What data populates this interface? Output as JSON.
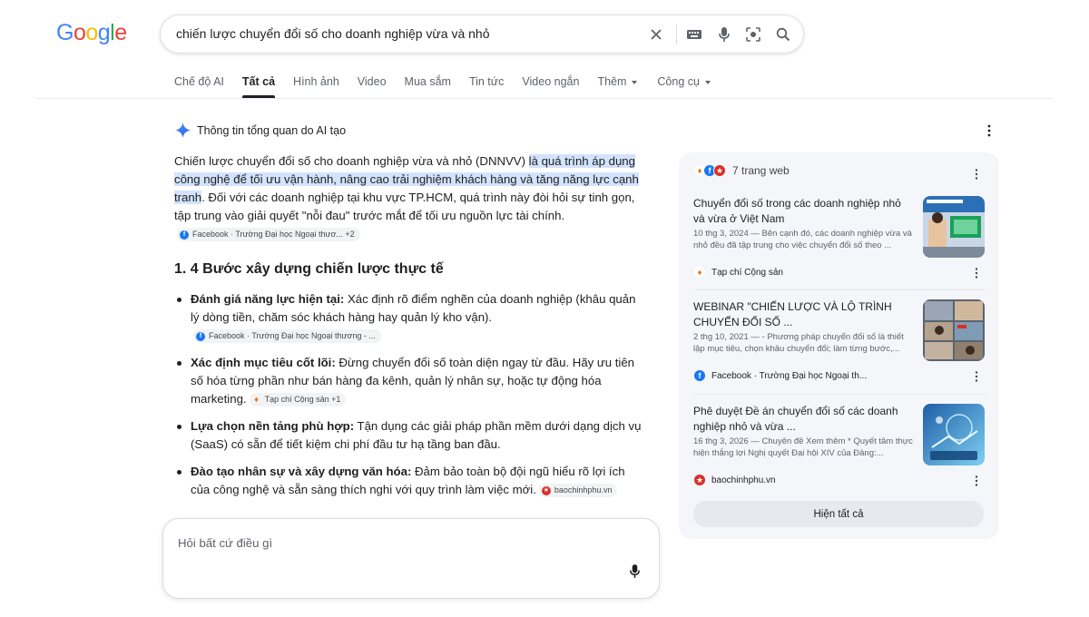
{
  "logo": {
    "text": "Google",
    "colors": [
      "#4285f4",
      "#ea4335",
      "#fbbc05",
      "#4285f4",
      "#34a853",
      "#ea4335"
    ]
  },
  "search": {
    "query": "chiến lược chuyển đổi số cho doanh nghiệp vừa và nhỏ"
  },
  "tabs": [
    {
      "label": "Chế độ AI"
    },
    {
      "label": "Tất cả"
    },
    {
      "label": "Hình ảnh"
    },
    {
      "label": "Video"
    },
    {
      "label": "Mua sắm"
    },
    {
      "label": "Tin tức"
    },
    {
      "label": "Video ngắn"
    },
    {
      "label": "Thêm"
    },
    {
      "label": "Công cụ"
    }
  ],
  "ai_overview": {
    "heading": "Thông tin tổng quan do AI tạo",
    "para_pre": "Chiến lược chuyển đổi số cho doanh nghiệp vừa và nhỏ (DNNVV) ",
    "para_hl": "là quá trình áp dụng công nghệ để tối ưu vận hành, nâng cao trải nghiệm khách hàng và tăng năng lực cạnh tranh",
    "para_post": ". Đối với các doanh nghiệp tại khu vực TP.HCM, quá trình này đòi hỏi sự tinh gọn, tập trung vào giải quyết \"nỗi đau\" trước mắt để tối ưu nguồn lực tài chính.",
    "para_chip": "Facebook · Trường Đại học Ngoại thươ... +2",
    "section_title": "1. 4 Bước xây dựng chiến lược thực tế",
    "bullets": [
      {
        "bold": "Đánh giá năng lực hiện tại:",
        "text": " Xác định rõ điểm nghẽn của doanh nghiệp (khâu quản lý dòng tiền, chăm sóc khách hàng hay quản lý kho vận).",
        "chip": "Facebook · Trường Đại học Ngoại thương - ..."
      },
      {
        "bold": "Xác định mục tiêu cốt lõi:",
        "text": " Đừng chuyển đổi số toàn diện ngay từ đầu. Hãy ưu tiên số hóa từng phần như bán hàng đa kênh, quản lý nhân sự, hoặc tự động hóa marketing.",
        "chip": "Tạp chí Cộng sản +1"
      },
      {
        "bold": "Lựa chọn nền tảng phù hợp:",
        "text": " Tận dụng các giải pháp phần mềm dưới dạng dịch vụ (SaaS) có sẵn để tiết kiệm chi phí đầu tư hạ tầng ban đầu.",
        "chip": ""
      },
      {
        "bold": "Đào tạo nhân sự và xây dựng văn hóa:",
        "text": " Đảm bảo toàn bộ đội ngũ hiểu rõ lợi ích của công nghệ và sẵn sàng thích nghi với quy trình làm việc mới.",
        "chip": "baochinhphu.vn"
      }
    ],
    "ask_placeholder": "Hỏi bất cứ điều gì"
  },
  "sources_panel": {
    "count_label": "7 trang web",
    "show_all": "Hiện tất cả",
    "cards": [
      {
        "title": "Chuyển đổi số trong các doanh nghiệp nhỏ và vừa ở Việt Nam",
        "snippet": "10 thg 3, 2024 — Bên cạnh đó, các doanh nghiệp vừa và nhỏ đều đã tập trung cho việc chuyển đổi số theo ...",
        "source": "Tạp chí Cộng sản"
      },
      {
        "title": "WEBINAR \"CHIẾN LƯỢC VÀ LỘ TRÌNH CHUYỂN ĐỔI SỐ ...",
        "snippet": "2 thg 10, 2021 — - Phương pháp chuyển đổi số là thiết lập mục tiêu, chọn khâu chuyển đổi; làm từng bước,...",
        "source": "Facebook · Trường Đại học Ngoại th..."
      },
      {
        "title": "Phê duyệt Đề án chuyển đổi số các doanh nghiệp nhỏ và vừa ...",
        "snippet": "16 thg 3, 2026 — Chuyên đề Xem thêm * Quyết tâm thực hiện thắng lợi Nghị quyết Đại hội XIV của Đảng:...",
        "source": "baochinhphu.vn"
      }
    ]
  }
}
